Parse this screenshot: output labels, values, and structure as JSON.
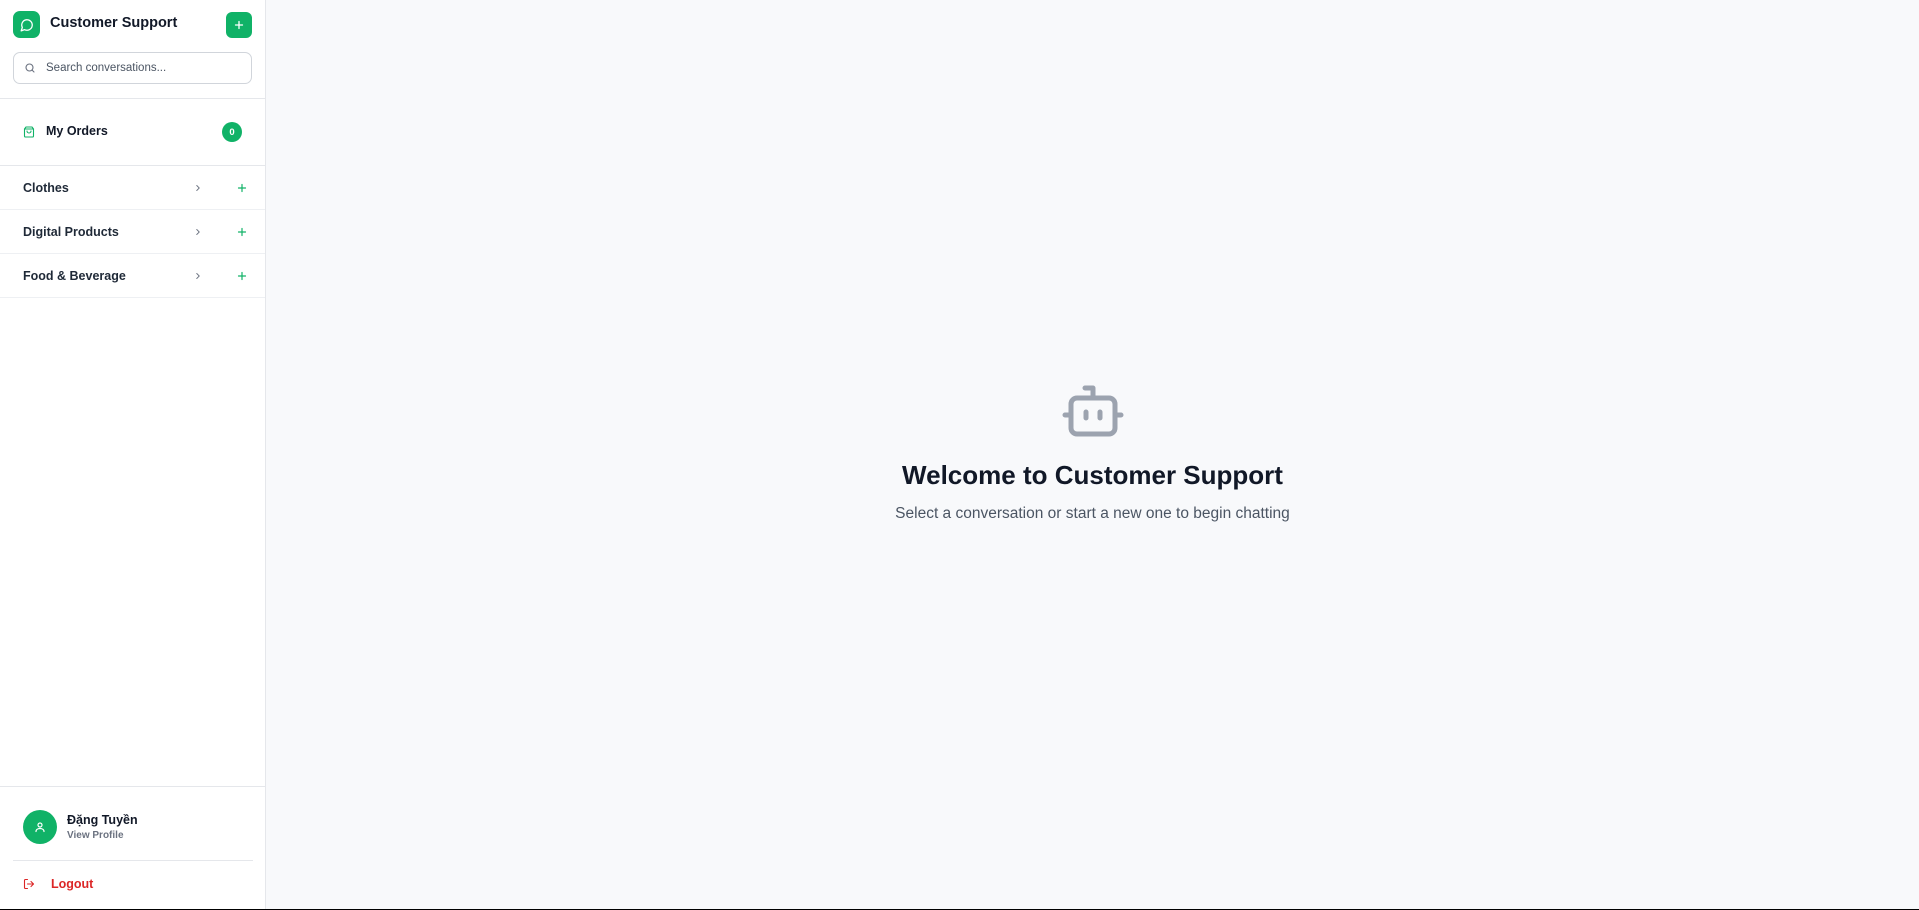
{
  "app": {
    "title": "Customer Support",
    "accent_color": "#10b267",
    "logo_icon": "chat-bubble-icon",
    "new_conversation_icon": "plus-icon"
  },
  "search": {
    "placeholder": "Search conversations...",
    "icon": "search-icon"
  },
  "orders": {
    "label": "My Orders",
    "count": "0",
    "icon": "shopping-bag-icon"
  },
  "categories": [
    {
      "label": "Clothes"
    },
    {
      "label": "Digital Products"
    },
    {
      "label": "Food & Beverage"
    }
  ],
  "user": {
    "name": "Đặng Tuyền",
    "view_profile": "View Profile",
    "avatar_icon": "user-icon"
  },
  "logout": {
    "label": "Logout",
    "color": "#dc2626",
    "icon": "logout-icon"
  },
  "welcome": {
    "icon": "bot-icon",
    "title": "Welcome to Customer Support",
    "subtitle": "Select a conversation or start a new one to begin chatting"
  }
}
